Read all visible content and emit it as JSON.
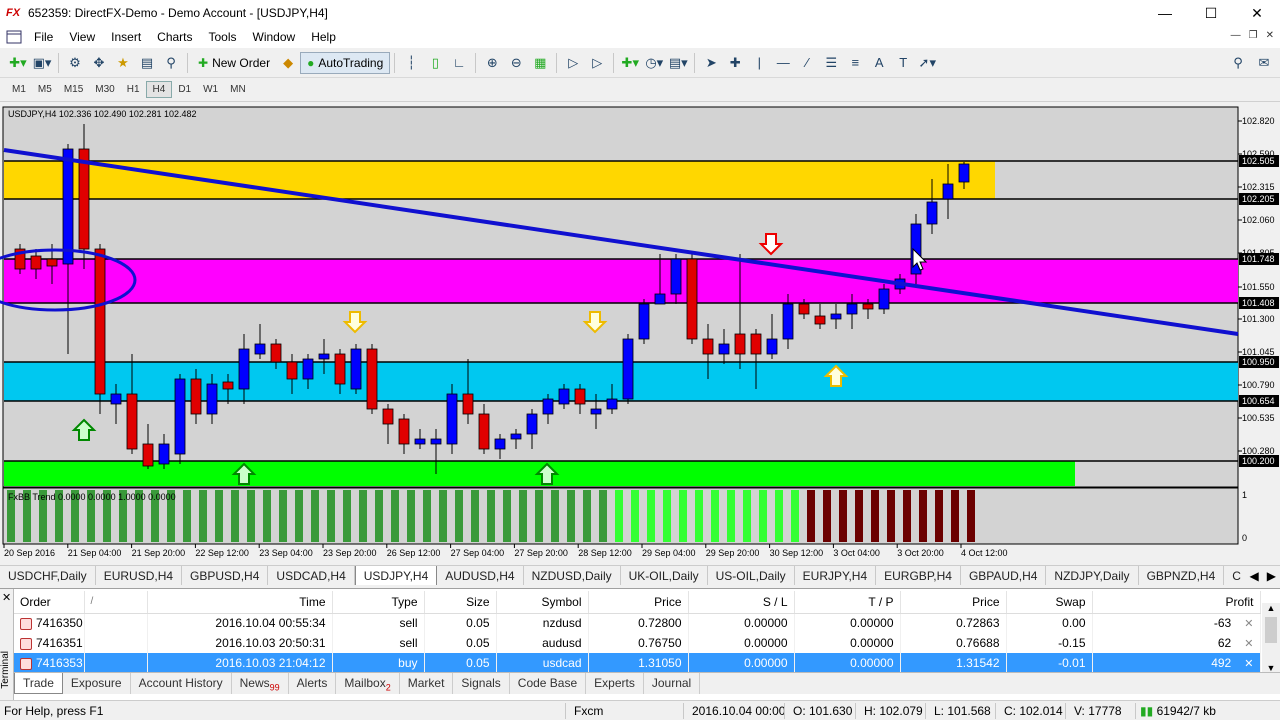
{
  "window": {
    "title": "652359: DirectFX-Demo - Demo Account - [USDJPY,H4]",
    "app_icon": "FX"
  },
  "menu": [
    "File",
    "View",
    "Insert",
    "Charts",
    "Tools",
    "Window",
    "Help"
  ],
  "toolbar": {
    "new_order": "New Order",
    "autotrading": "AutoTrading"
  },
  "timeframes": [
    "M1",
    "M5",
    "M15",
    "M30",
    "H1",
    "H4",
    "D1",
    "W1",
    "MN"
  ],
  "timeframe_active": "H4",
  "chart": {
    "header": "USDJPY,H4  102.336 102.490 102.281 102.482",
    "indicator_label": "FxBB Trend 0.0000 0.0000 1.0000 0.0000",
    "price_labels": [
      "102.820",
      "102.590",
      "102.315",
      "102.060",
      "101.805",
      "101.550",
      "101.300",
      "101.045",
      "100.790",
      "100.535",
      "100.280"
    ],
    "highlight_levels": [
      {
        "text": "102.505",
        "color": "#000000"
      },
      {
        "text": "102.205",
        "color": "#000000"
      },
      {
        "text": "101.748",
        "color": "#000000"
      },
      {
        "text": "101.408",
        "color": "#000000"
      },
      {
        "text": "100.950",
        "color": "#000000"
      },
      {
        "text": "100.654",
        "color": "#000000"
      },
      {
        "text": "100.200",
        "color": "#000000"
      }
    ],
    "indicator_scale": [
      "1",
      "0"
    ],
    "time_labels": [
      "20 Sep 2016",
      "21 Sep 04:00",
      "21 Sep 20:00",
      "22 Sep 12:00",
      "23 Sep 04:00",
      "23 Sep 20:00",
      "26 Sep 12:00",
      "27 Sep 04:00",
      "27 Sep 20:00",
      "28 Sep 12:00",
      "29 Sep 04:00",
      "29 Sep 20:00",
      "30 Sep 12:00",
      "3 Oct 04:00",
      "3 Oct 20:00",
      "4 Oct 12:00"
    ],
    "colors": {
      "background": "#d3d3d3",
      "yellow_zone": "#ffd700",
      "magenta_zone": "#ff00ff",
      "cyan_zone": "#00c8f0",
      "green_zone": "#00ff00",
      "trendline": "#1010d0",
      "bull_candle": "#0000ff",
      "bear_candle": "#e00000"
    }
  },
  "chart_tabs": [
    "USDCHF,Daily",
    "EURUSD,H4",
    "GBPUSD,H4",
    "USDCAD,H4",
    "USDJPY,H4",
    "AUDUSD,H4",
    "NZDUSD,Daily",
    "UK-OIL,Daily",
    "US-OIL,Daily",
    "EURJPY,H4",
    "EURGBP,H4",
    "GBPAUD,H4",
    "NZDJPY,Daily",
    "GBPNZD,H4",
    "C"
  ],
  "chart_tab_active": "USDJPY,H4",
  "orders": {
    "columns": [
      "Order",
      "/",
      "Time",
      "Type",
      "Size",
      "Symbol",
      "Price",
      "S / L",
      "T / P",
      "Price",
      "Swap",
      "Profit"
    ],
    "rows": [
      {
        "order": "7416350",
        "time": "2016.10.04 00:55:34",
        "type": "sell",
        "size": "0.05",
        "symbol": "nzdusd",
        "price": "0.72800",
        "sl": "0.00000",
        "tp": "0.00000",
        "cur": "0.72863",
        "swap": "0.00",
        "profit": "-63"
      },
      {
        "order": "7416351",
        "time": "2016.10.03 20:50:31",
        "type": "sell",
        "size": "0.05",
        "symbol": "audusd",
        "price": "0.76750",
        "sl": "0.00000",
        "tp": "0.00000",
        "cur": "0.76688",
        "swap": "-0.15",
        "profit": "62"
      },
      {
        "order": "7416353",
        "time": "2016.10.03 21:04:12",
        "type": "buy",
        "size": "0.05",
        "symbol": "usdcad",
        "price": "1.31050",
        "sl": "0.00000",
        "tp": "0.00000",
        "cur": "1.31542",
        "swap": "-0.01",
        "profit": "492"
      }
    ]
  },
  "terminal": {
    "side_label": "Terminal",
    "tabs": [
      {
        "label": "Trade",
        "badge": ""
      },
      {
        "label": "Exposure",
        "badge": ""
      },
      {
        "label": "Account History",
        "badge": ""
      },
      {
        "label": "News",
        "badge": "99"
      },
      {
        "label": "Alerts",
        "badge": ""
      },
      {
        "label": "Mailbox",
        "badge": "2"
      },
      {
        "label": "Market",
        "badge": ""
      },
      {
        "label": "Signals",
        "badge": ""
      },
      {
        "label": "Code Base",
        "badge": ""
      },
      {
        "label": "Experts",
        "badge": ""
      },
      {
        "label": "Journal",
        "badge": ""
      }
    ]
  },
  "status": {
    "help": "For Help, press F1",
    "profile": "Fxcm",
    "datetime": "2016.10.04 00:00",
    "open": "O: 101.630",
    "high": "H: 102.079",
    "low": "L: 101.568",
    "close": "C: 102.014",
    "volume": "V: 17778",
    "traffic": "61942/7 kb"
  }
}
